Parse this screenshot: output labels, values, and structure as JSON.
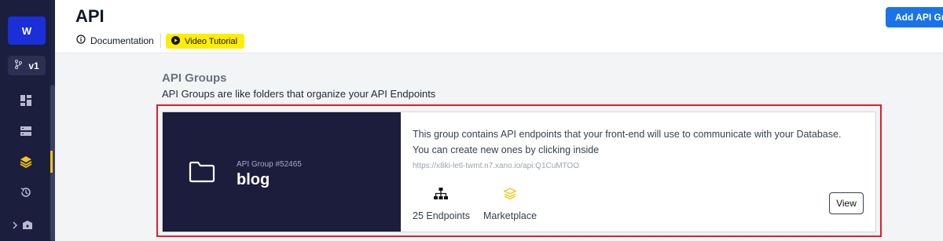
{
  "sidebar": {
    "workspace_initial": "W",
    "branch_label": "v1",
    "icons": [
      "dashboard-icon",
      "database-icon",
      "api-icon",
      "history-icon",
      "marketplace-icon"
    ],
    "accent_color": "#f5c518"
  },
  "header": {
    "title": "API",
    "documentation_label": "Documentation",
    "video_tutorial_label": "Video Tutorial",
    "add_button_label": "Add API Gro"
  },
  "main": {
    "section_title": "API Groups",
    "section_description": "API Groups are like folders that organize your API Endpoints",
    "groups": [
      {
        "id_label": "API Group #52465",
        "name": "blog",
        "description": "This group contains API endpoints that your front-end will use to communicate with your Database. You can create new ones by clicking inside",
        "url": "https://x8ki-letl-twmt.n7.xano.io/api:Q1CuMTOO",
        "endpoints_label": "25 Endpoints",
        "marketplace_label": "Marketplace",
        "view_label": "View"
      }
    ]
  },
  "colors": {
    "highlight_border": "#e11d2a",
    "primary_button": "#1a73e8",
    "video_button": "#ffee00",
    "sidebar_bg": "#1b1e3d",
    "card_left_bg": "#1c1d3d"
  }
}
